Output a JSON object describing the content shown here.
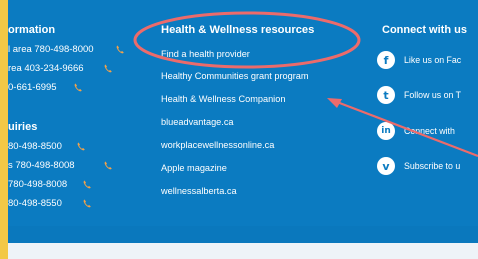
{
  "contact": {
    "heading": "ormation",
    "lines": [
      "l area 780-498-8000",
      "rea 403-234-9666",
      "0-661-6995"
    ]
  },
  "inquiries": {
    "heading": "uiries",
    "lines": [
      "80-498-8500",
      "s 780-498-8008",
      "780-498-8008",
      "80-498-8550"
    ]
  },
  "resources": {
    "heading": "Health & Wellness resources",
    "links": [
      "Find a health provider",
      "Healthy Communities grant program",
      "Health & Wellness Companion",
      "blueadvantage.ca",
      "workplacewellnessonline.ca",
      "Apple magazine",
      "wellnessalberta.ca"
    ]
  },
  "connect": {
    "heading": "Connect with us",
    "items": [
      {
        "icon": "f",
        "label": "Like us on Fac"
      },
      {
        "icon": "t",
        "label": "Follow us on T"
      },
      {
        "icon": "in",
        "label": "Connect with"
      },
      {
        "icon": "v",
        "label": "Subscribe to u"
      }
    ]
  },
  "colors": {
    "footer_bg": "#0b7bc1",
    "frame": "#f3c846",
    "annotation": "#ec6b6b"
  }
}
